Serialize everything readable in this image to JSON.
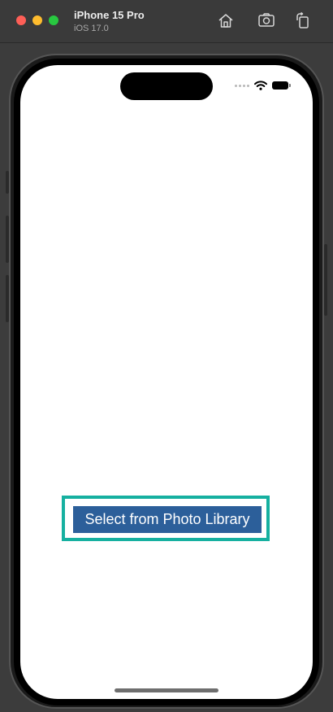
{
  "window": {
    "device_name": "iPhone 15 Pro",
    "os_version": "iOS 17.0",
    "toolbar_icons": [
      "home-icon",
      "screenshot-icon",
      "rotate-icon"
    ]
  },
  "screen": {
    "status_icons": [
      "signal-dots-icon",
      "wifi-icon",
      "battery-icon"
    ],
    "photo_button_label": "Select from Photo Library"
  },
  "colors": {
    "button_bg": "#2c5f9a",
    "highlight_border": "#16b0a0",
    "traffic_red": "#fe5f57",
    "traffic_yellow": "#febc2e",
    "traffic_green": "#28c840"
  }
}
